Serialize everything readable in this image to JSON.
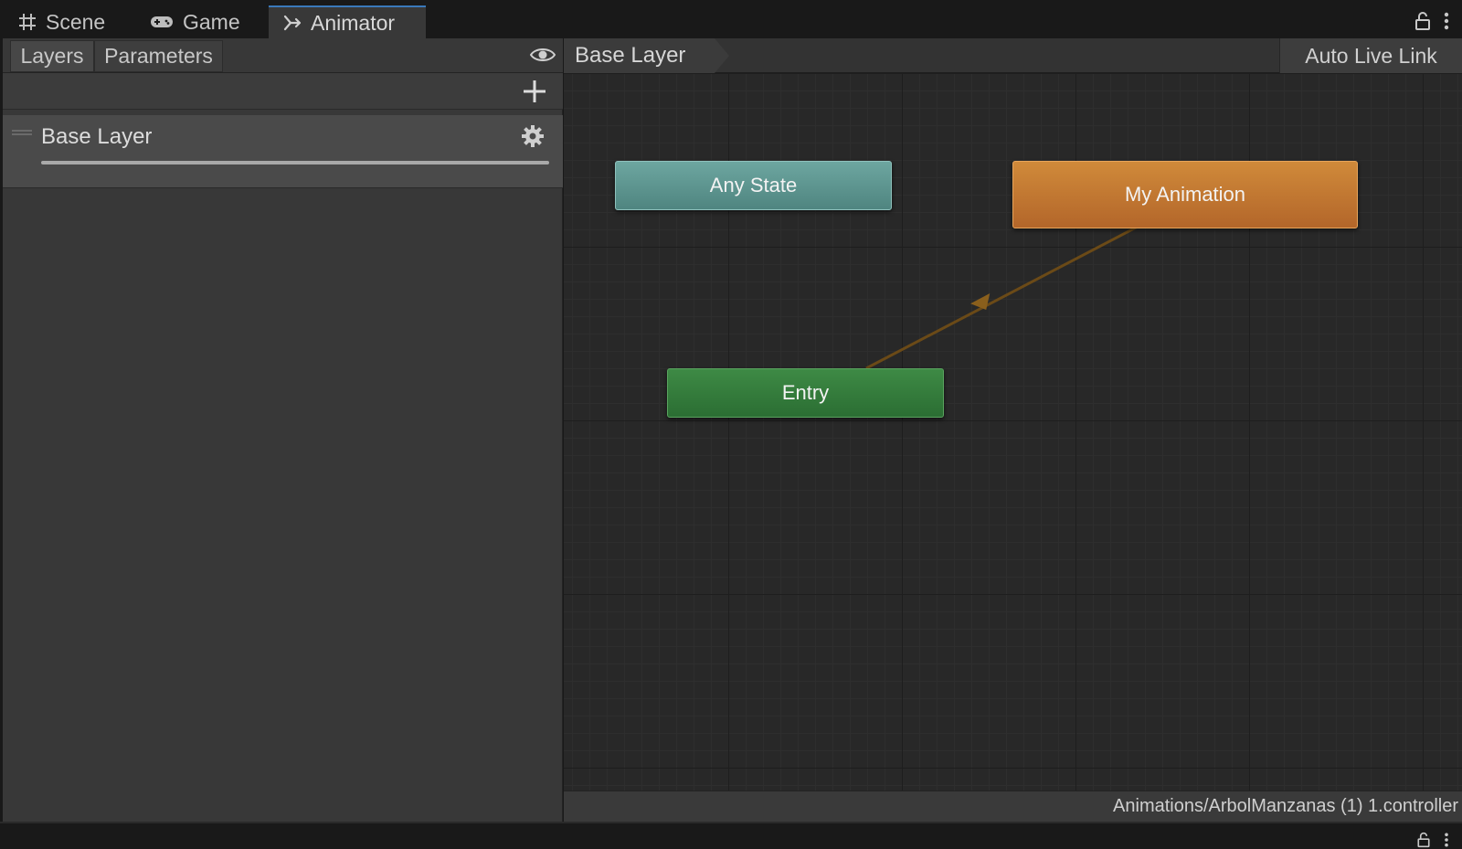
{
  "window": {
    "tabs": [
      {
        "label": "Scene",
        "icon": "grid-icon"
      },
      {
        "label": "Game",
        "icon": "gamepad-icon"
      },
      {
        "label": "Animator",
        "icon": "animator-icon"
      }
    ],
    "active_tab": "Animator"
  },
  "left_panel": {
    "subtabs": [
      "Layers",
      "Parameters"
    ],
    "active_subtab": "Layers",
    "layers": [
      {
        "name": "Base Layer",
        "weight": 1.0
      }
    ]
  },
  "graph": {
    "breadcrumb": "Base Layer",
    "live_link_label": "Auto Live Link",
    "nodes": {
      "any_state": "Any State",
      "my_animation": "My Animation",
      "entry": "Entry"
    },
    "colors": {
      "any_state": "#5f9692",
      "default_state": "#c2772f",
      "entry": "#357c3b",
      "transition": "#7a5418"
    }
  },
  "status": {
    "path": "Animations/ArbolManzanas (1) 1.controller"
  }
}
